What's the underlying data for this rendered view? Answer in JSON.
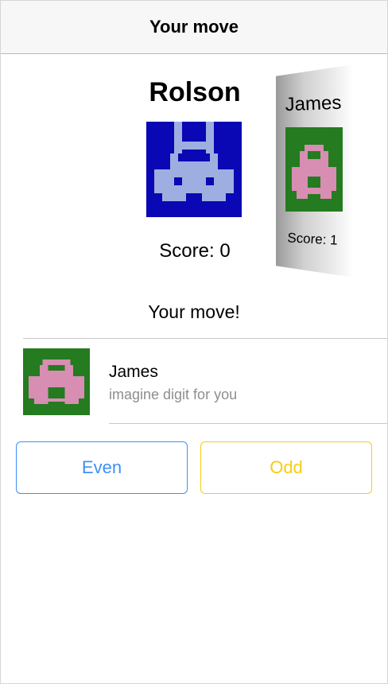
{
  "navbar": {
    "title": "Your move"
  },
  "player": {
    "name": "Rolson",
    "score_text": "Score: 0",
    "avatar_icon": "blue-space-invader-avatar",
    "avatar_bg": "#0a08b4",
    "avatar_fg": "#9eaee0"
  },
  "opponent": {
    "name": "James",
    "score_text": "Score: 1",
    "avatar_icon": "green-space-invader-avatar",
    "avatar_bg": "#257b20",
    "avatar_fg": "#d88db3"
  },
  "status": {
    "message": "Your move!"
  },
  "message": {
    "sender": "James",
    "text": "imagine digit for you",
    "avatar_icon": "green-space-invader-avatar"
  },
  "buttons": {
    "even_label": "Even",
    "odd_label": "Odd",
    "even_color": "#3f8ff5",
    "odd_color": "#f7cc14"
  }
}
